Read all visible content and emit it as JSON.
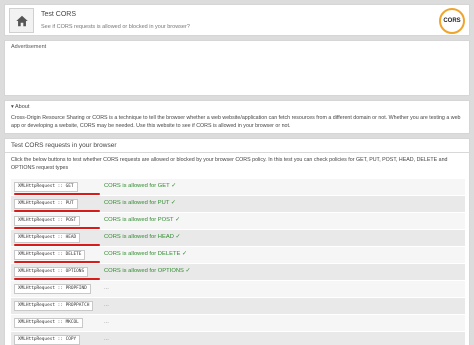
{
  "header": {
    "title": "Test CORS",
    "subtitle": "See if CORS requests is allowed or blocked in your browser?",
    "logo_text": "CORS",
    "home_icon": "home-icon"
  },
  "ad": {
    "label": "Advertisement"
  },
  "about": {
    "heading": "▾ About",
    "text": "Cross-Origin Resource Sharing or CORS is a technique to tell the browser whether a web website/application can fetch resources from a different domain or not. Whether you are testing a web app or developing a website, CORS may be needed. Use this website to see if CORS is allowed in your browser or not."
  },
  "tests": {
    "heading": "Test CORS requests in your browser",
    "description": "Click the below buttons to test whether CORS requests are allowed or blocked by your browser CORS policy. In this test you can check policies for GET, PUT, POST, HEAD, DELETE and OPTIONS request types",
    "rows": [
      {
        "button": "XMLHttpRequest :: GET",
        "result": "CORS is allowed for GET ✓",
        "status": "allowed"
      },
      {
        "button": "XMLHttpRequest :: PUT",
        "result": "CORS is allowed for PUT ✓",
        "status": "allowed"
      },
      {
        "button": "XMLHttpRequest :: POST",
        "result": "CORS is allowed for POST ✓",
        "status": "allowed"
      },
      {
        "button": "XMLHttpRequest :: HEAD",
        "result": "CORS is allowed for HEAD ✓",
        "status": "allowed"
      },
      {
        "button": "XMLHttpRequest :: DELETE",
        "result": "CORS is allowed for DELETE ✓",
        "status": "allowed"
      },
      {
        "button": "XMLHttpRequest :: OPTIONS",
        "result": "CORS is allowed for OPTIONS ✓",
        "status": "allowed"
      },
      {
        "button": "XMLHttpRequest :: PROPFIND",
        "result": "...",
        "status": "pending"
      },
      {
        "button": "XMLHttpRequest :: PROPPATCH",
        "result": "...",
        "status": "pending"
      },
      {
        "button": "XMLHttpRequest :: MKCOL",
        "result": "...",
        "status": "pending"
      },
      {
        "button": "XMLHttpRequest :: COPY",
        "result": "...",
        "status": "pending"
      }
    ]
  },
  "colors": {
    "allowed": "#2e8b2e",
    "underline": "#d81b1b",
    "logo_ring": "#f0a52a"
  }
}
